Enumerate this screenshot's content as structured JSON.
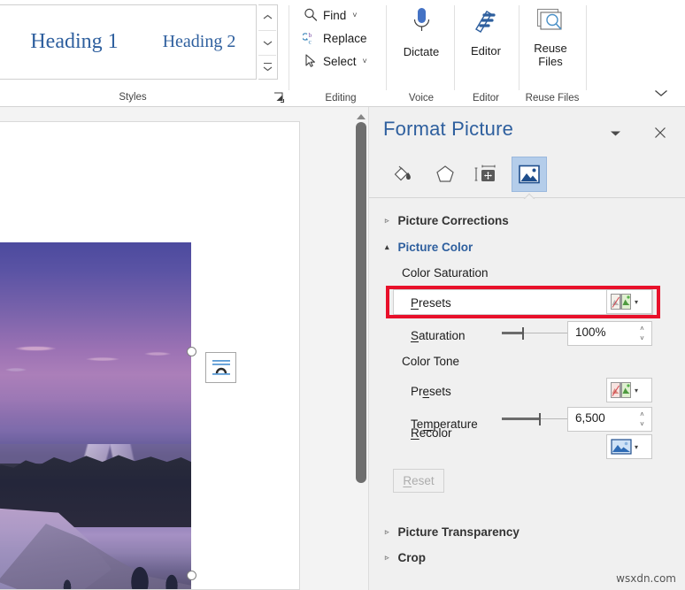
{
  "ribbon": {
    "styles": {
      "group_label": "Styles",
      "items": [
        {
          "label": "Heading 1"
        },
        {
          "label": "Heading 2"
        }
      ],
      "scroll_up": "˄",
      "scroll_down": "˅",
      "more": "˅",
      "dialog_launcher_icon": "dialog-launcher-icon"
    },
    "editing": {
      "group_label": "Editing",
      "items": [
        {
          "label": "Find",
          "icon": "search-icon",
          "has_dropdown": true
        },
        {
          "label": "Replace",
          "icon": "replace-icon",
          "has_dropdown": false
        },
        {
          "label": "Select",
          "icon": "cursor-arrow-icon",
          "has_dropdown": true
        }
      ]
    },
    "voice": {
      "group_label": "Voice",
      "button_label": "Dictate",
      "icon": "microphone-icon"
    },
    "editor": {
      "group_label": "Editor",
      "button_label": "Editor",
      "icon": "editor-pen-icon"
    },
    "reuse_files": {
      "group_label": "Reuse Files",
      "button_label_line1": "Reuse",
      "button_label_line2": "Files",
      "icon": "reuse-files-icon"
    },
    "collapse_ribbon_icon": "chevron-down-icon"
  },
  "document": {
    "picture_alt": "purple sunset lake and forest landscape photo",
    "layout_options_icon": "text-wrapping-icon",
    "selection_handles": [
      "top-right-handle",
      "right-middle-handle"
    ],
    "scrollbar": {
      "up_arrow_icon": "scroll-up-icon"
    }
  },
  "pane": {
    "title": "Format Picture",
    "menu_icon": "chevron-down-icon",
    "close_icon": "close-icon",
    "tabs": [
      {
        "name": "fill-and-line",
        "icon": "paint-bucket-icon",
        "selected": false
      },
      {
        "name": "effects",
        "icon": "pentagon-icon",
        "selected": false
      },
      {
        "name": "layout-and-properties",
        "icon": "size-properties-icon",
        "selected": false
      },
      {
        "name": "picture",
        "icon": "picture-icon",
        "selected": true
      }
    ],
    "sections": {
      "picture_corrections": {
        "label": "Picture Corrections",
        "expanded": false,
        "triangle": "▹"
      },
      "picture_color": {
        "label": "Picture Color",
        "expanded": true,
        "triangle": "▴"
      },
      "picture_transparency": {
        "label": "Picture Transparency",
        "expanded": false,
        "triangle": "▹"
      },
      "crop": {
        "label": "Crop",
        "expanded": false,
        "triangle": "▹"
      }
    },
    "color_saturation": {
      "group_label": "Color Saturation",
      "presets_label": "Presets",
      "presets_label_accel": "P",
      "presets_icon": "saturation-presets-icon",
      "presets_caret": "▾",
      "saturation_label": "Saturation",
      "saturation_label_accel": "S",
      "saturation_value": "100%",
      "saturation_slider_percent": 30
    },
    "color_tone": {
      "group_label": "Color Tone",
      "presets_label": "Presets",
      "presets_label_accel": "e",
      "presets_icon": "color-tone-presets-icon",
      "presets_caret": "▾",
      "temperature_label": "Temperature",
      "temperature_label_accel": "m",
      "temperature_value": "6,500",
      "temperature_slider_percent": 55,
      "recolor_label": "Recolor",
      "recolor_label_accel": "R",
      "recolor_icon": "recolor-picture-icon",
      "recolor_caret": "▾"
    },
    "reset_button": {
      "label": "Reset",
      "label_accel": "R",
      "disabled": true
    },
    "spinner_up": "˄",
    "spinner_down": "˅"
  },
  "watermark": "wsxdn.com",
  "colors": {
    "accent_blue": "#2e5f9e",
    "highlight_red": "#e8102a",
    "tab_selected_bg": "#b4cdea",
    "pane_bg": "#f0f0f0"
  }
}
